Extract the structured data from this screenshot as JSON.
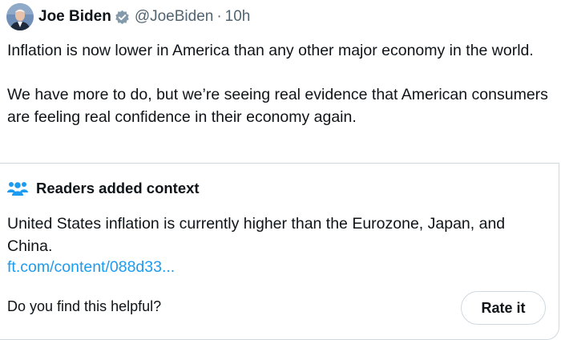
{
  "author": {
    "name": "Joe Biden",
    "handle": "@JoeBiden",
    "separator": "·",
    "time": "10h",
    "avatar_icon": "portrait-avatar",
    "verified_icon": "verified-badge-icon"
  },
  "tweet": {
    "paragraphs": [
      "Inflation is now lower in America than any other major economy in the world.",
      "We have more to do, but we’re seeing real evidence that American consumers are feeling real confidence in their economy again."
    ]
  },
  "community_note": {
    "icon": "people-icon",
    "title": "Readers added context",
    "text": "United States inflation is currently higher than the Eurozone, Japan, and China.",
    "link": "ft.com/content/088d33...",
    "question": "Do you find this helpful?",
    "rate_label": "Rate it"
  },
  "colors": {
    "text": "#0f1419",
    "secondary": "#536471",
    "link": "#1d9bf0",
    "border": "#cfd9de",
    "verified_badge": "#829aab"
  }
}
